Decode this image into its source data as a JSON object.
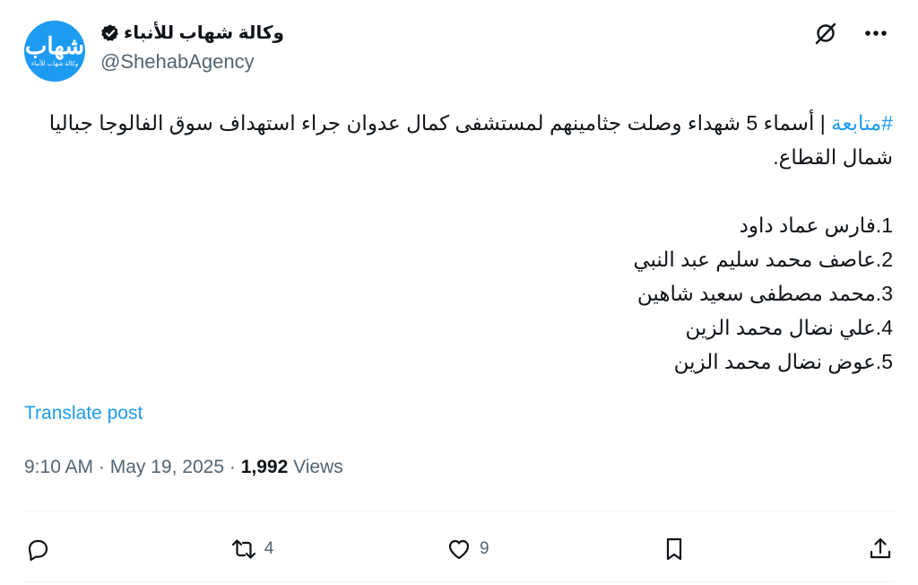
{
  "header": {
    "display_name": "وكالة شهاب للأنباء",
    "handle": "@ShehabAgency",
    "avatar_logo_main": "شهاب",
    "avatar_logo_sub": "وكالة شهاب للأنباء",
    "verified_icon": "verified-badge-icon",
    "grok_icon": "grok-icon",
    "more_icon": "more-icon"
  },
  "tweet": {
    "hashtag": "#متابعة",
    "intro": " | أسماء 5 شهداء وصلت جثامينهم لمستشفى كمال عدوان جراء استهداف سوق الفالوجا جباليا شمال القطاع.",
    "names": [
      "1.فارس عماد داود",
      "2.عاصف محمد سليم عبد النبي",
      "3.محمد مصطفى سعيد شاهين",
      "4.علي نضال محمد الزين",
      "5.عوض نضال محمد الزين"
    ],
    "translate_label": "Translate post"
  },
  "meta": {
    "time": "9:10 AM",
    "date": "May 19, 2025",
    "separator": "·",
    "views_count": "1,992",
    "views_label": "Views"
  },
  "actions": {
    "reply_count": "",
    "retweet_count": "4",
    "like_count": "9",
    "bookmark_count": "",
    "icons": [
      "reply-icon",
      "retweet-icon",
      "like-icon",
      "bookmark-icon",
      "share-icon"
    ]
  },
  "colors": {
    "accent": "#1d9bf0",
    "text": "#0f1419",
    "secondary": "#536471",
    "divider": "#eff3f4"
  }
}
